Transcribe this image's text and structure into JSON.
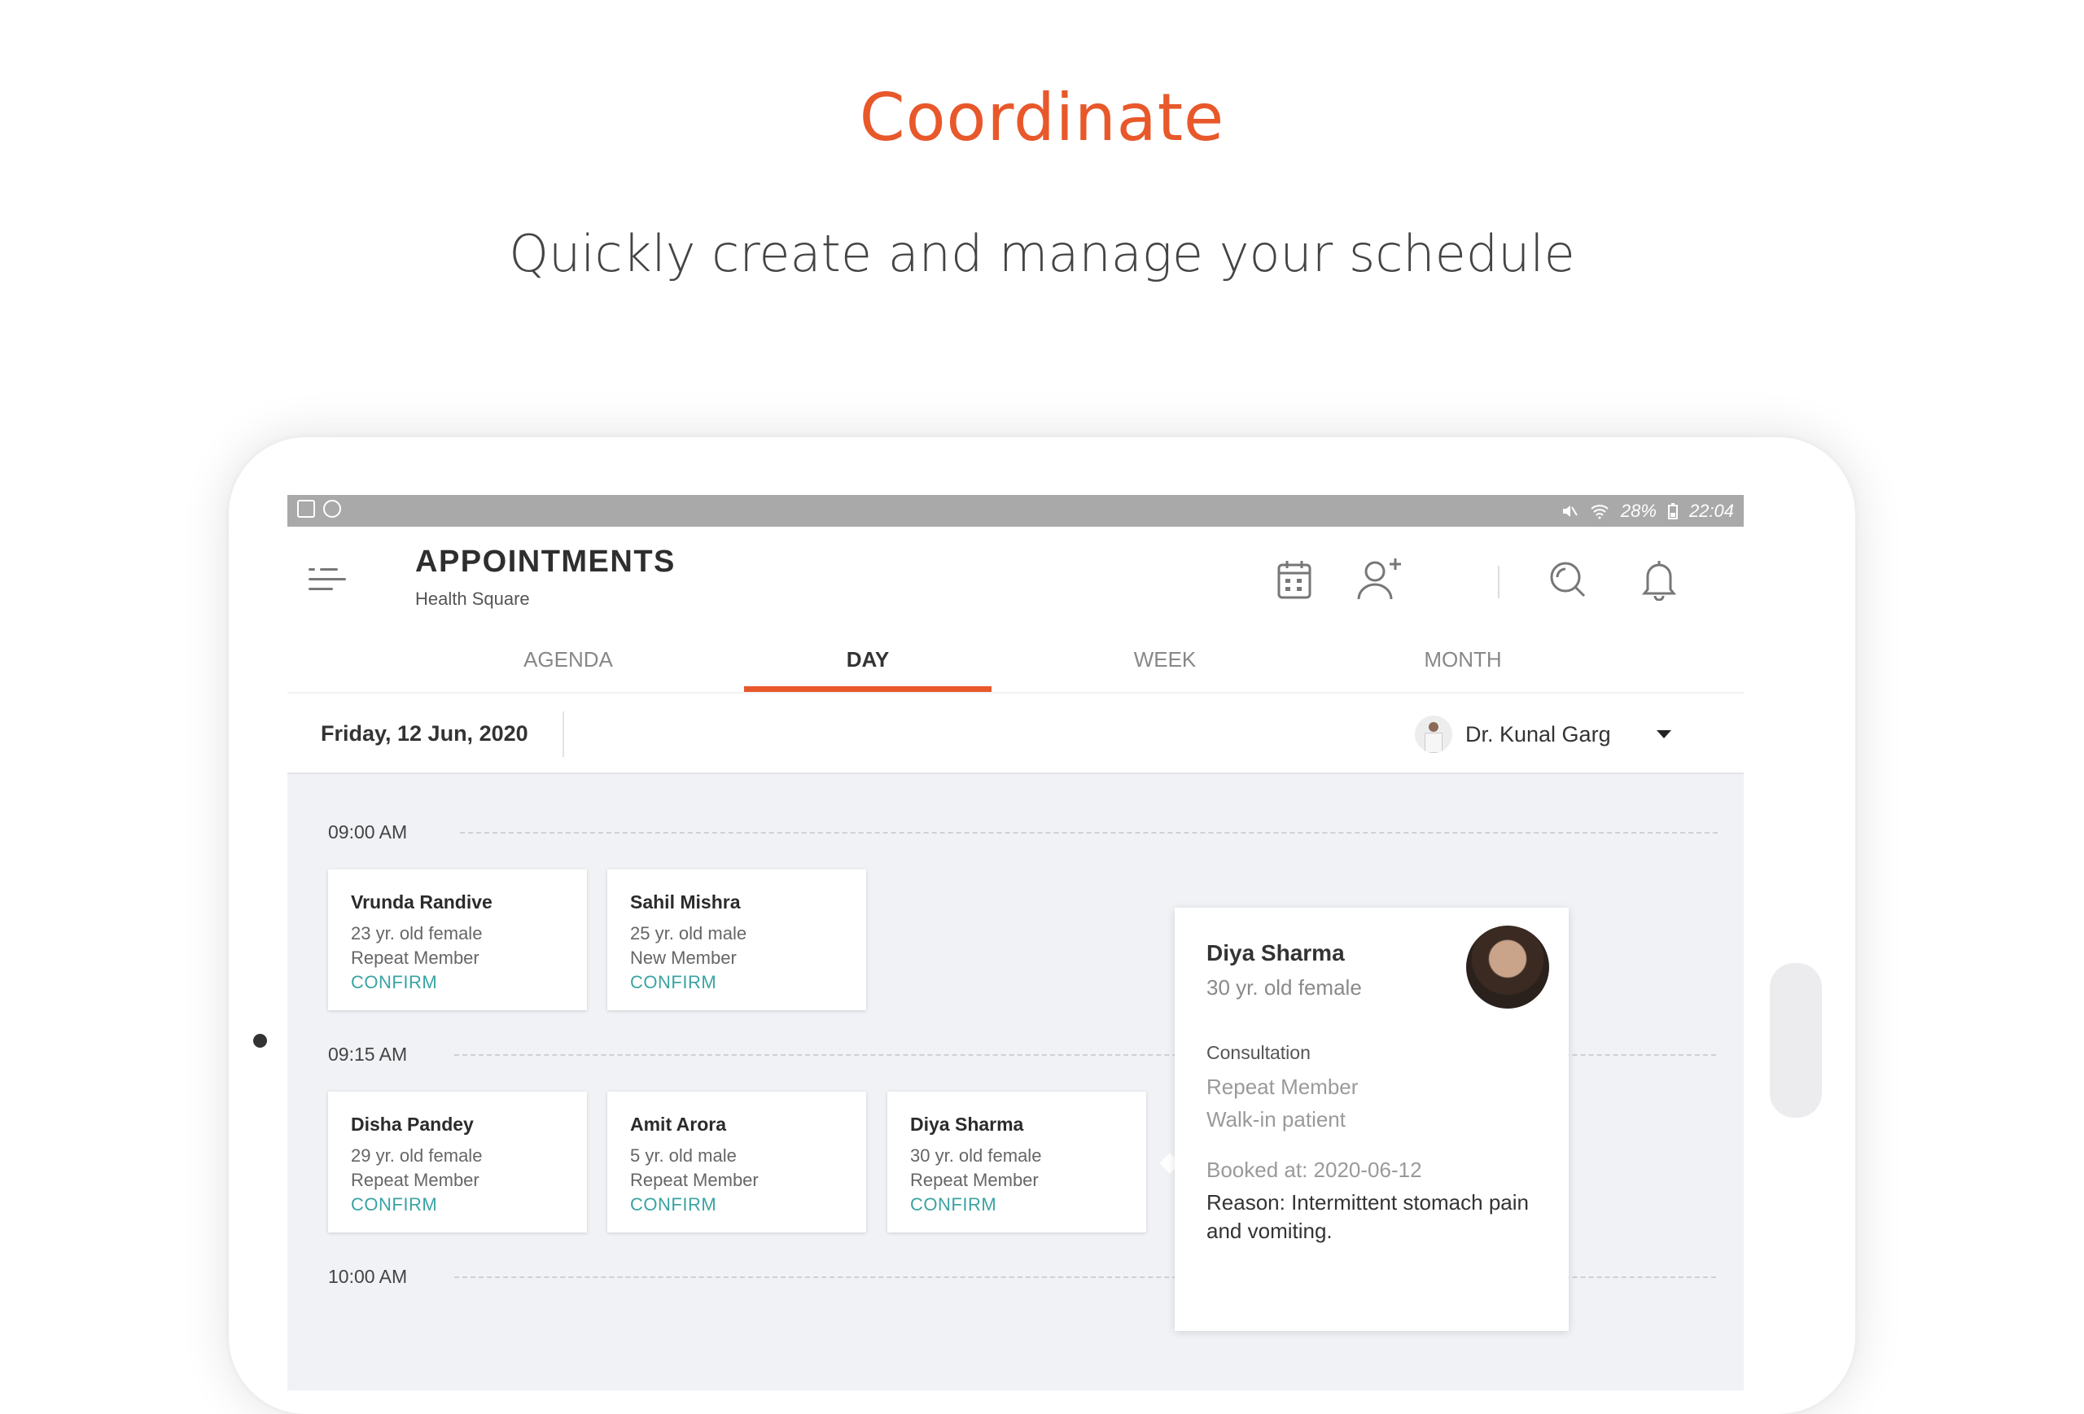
{
  "promo": {
    "headline": "Coordinate",
    "subline": "Quickly create and manage your schedule"
  },
  "status_bar": {
    "battery": "28%",
    "time": "22:04"
  },
  "app_bar": {
    "title": "APPOINTMENTS",
    "subtitle": "Health Square"
  },
  "tabs": [
    {
      "label": "AGENDA",
      "active": false
    },
    {
      "label": "DAY",
      "active": true
    },
    {
      "label": "WEEK",
      "active": false
    },
    {
      "label": "MONTH",
      "active": false
    }
  ],
  "date_bar": {
    "date": "Friday, 12 Jun, 2020",
    "doctor": "Dr. Kunal Garg"
  },
  "timeline": {
    "slots": [
      "09:00 AM",
      "09:15 AM",
      "10:00 AM"
    ]
  },
  "appointments": [
    {
      "name": "Vrunda Randive",
      "age": "23 yr. old female",
      "member": "Repeat Member",
      "action": "CONFIRM"
    },
    {
      "name": "Sahil Mishra",
      "age": "25 yr. old male",
      "member": "New Member",
      "action": "CONFIRM"
    },
    {
      "name": "Disha Pandey",
      "age": "29 yr. old female",
      "member": "Repeat Member",
      "action": "CONFIRM"
    },
    {
      "name": "Amit Arora",
      "age": "5 yr. old male",
      "member": "Repeat Member",
      "action": "CONFIRM"
    },
    {
      "name": "Diya Sharma",
      "age": "30 yr. old female",
      "member": "Repeat Member",
      "action": "CONFIRM"
    }
  ],
  "detail": {
    "name": "Diya Sharma",
    "age": "30 yr. old female",
    "type": "Consultation",
    "member": "Repeat Member",
    "visit": "Walk-in patient",
    "booked": "Booked at: 2020-06-12",
    "reason": "Reason: Intermittent stomach pain and vomiting."
  },
  "colors": {
    "accent": "#e8582a",
    "confirm": "#3aa3a3",
    "statusbar": "#a9a9a9",
    "background": "#f0f2f5"
  }
}
